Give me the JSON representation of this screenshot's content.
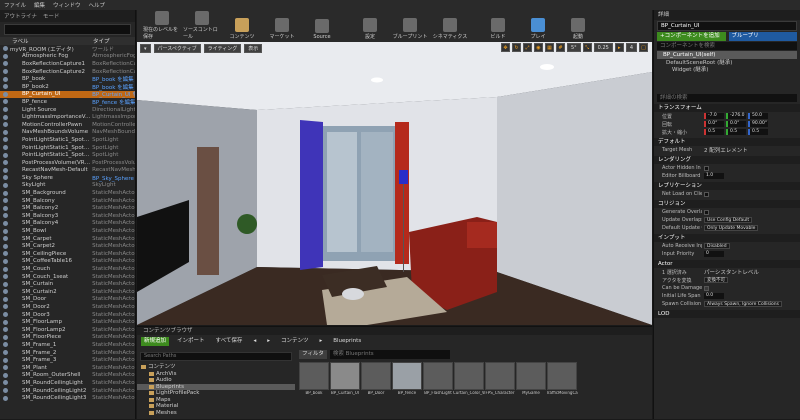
{
  "menu": [
    "ファイル",
    "編集",
    "ウィンドウ",
    "ヘルプ"
  ],
  "left_tabs": [
    "アウトライナ",
    "モード"
  ],
  "outliner": {
    "col_label": "ラベル",
    "col_type": "タイプ",
    "rows": [
      {
        "label": "myVR_ROOM (エディタ)",
        "type": "ワールド"
      },
      {
        "label": "Atmospheric Fog",
        "type": "AtmosphericFog"
      },
      {
        "label": "BoxReflectionCapture1",
        "type": "BoxReflectionCapture"
      },
      {
        "label": "BoxReflectionCapture2",
        "type": "BoxReflectionCapture"
      },
      {
        "label": "BP_book",
        "type": "BP_book を編集"
      },
      {
        "label": "BP_book2",
        "type": "BP_book を編集"
      },
      {
        "label": "BP_Curtain_UI",
        "type": "BP_Curtain_UI を編集"
      },
      {
        "label": "BP_fence",
        "type": "BP_fence を編集"
      },
      {
        "label": "Light Source",
        "type": "DirectionalLight"
      },
      {
        "label": "LightmassImportanceVolume",
        "type": "LightmassImportanceVolume"
      },
      {
        "label": "MotionControllerPawn",
        "type": "MotionControllerPawn"
      },
      {
        "label": "NavMeshBoundsVolume",
        "type": "NavMeshBoundsVolume"
      },
      {
        "label": "PointLightStatic1_SpotLight",
        "type": "SpotLight"
      },
      {
        "label": "PointLightStatic1_SpotLight2",
        "type": "SpotLight"
      },
      {
        "label": "PointLightStatic1_SpotLight3",
        "type": "SpotLight"
      },
      {
        "label": "PostProcessVolume(VRSetting)",
        "type": "PostProcessVolume"
      },
      {
        "label": "RecastNavMesh-Default",
        "type": "RecastNavMesh"
      },
      {
        "label": "Sky Sphere",
        "type": "BP_Sky_Sphere を編集"
      },
      {
        "label": "SkyLight",
        "type": "SkyLight"
      },
      {
        "label": "SM_Background",
        "type": "StaticMeshActor"
      },
      {
        "label": "SM_Balcony",
        "type": "StaticMeshActor"
      },
      {
        "label": "SM_Balcony2",
        "type": "StaticMeshActor"
      },
      {
        "label": "SM_Balcony3",
        "type": "StaticMeshActor"
      },
      {
        "label": "SM_Balcony4",
        "type": "StaticMeshActor"
      },
      {
        "label": "SM_Bowl",
        "type": "StaticMeshActor"
      },
      {
        "label": "SM_Carpet",
        "type": "StaticMeshActor"
      },
      {
        "label": "SM_Carpet2",
        "type": "StaticMeshActor"
      },
      {
        "label": "SM_CeilingPiece",
        "type": "StaticMeshActor"
      },
      {
        "label": "SM_CoffeeTable16",
        "type": "StaticMeshActor"
      },
      {
        "label": "SM_Couch",
        "type": "StaticMeshActor"
      },
      {
        "label": "SM_Couch_1seat",
        "type": "StaticMeshActor"
      },
      {
        "label": "SM_Curtain",
        "type": "StaticMeshActor"
      },
      {
        "label": "SM_Curtain2",
        "type": "StaticMeshActor"
      },
      {
        "label": "SM_Door",
        "type": "StaticMeshActor"
      },
      {
        "label": "SM_Door2",
        "type": "StaticMeshActor"
      },
      {
        "label": "SM_Door3",
        "type": "StaticMeshActor"
      },
      {
        "label": "SM_FloorLamp",
        "type": "StaticMeshActor"
      },
      {
        "label": "SM_FloorLamp2",
        "type": "StaticMeshActor"
      },
      {
        "label": "SM_FloorPiece",
        "type": "StaticMeshActor"
      },
      {
        "label": "SM_Frame_1",
        "type": "StaticMeshActor"
      },
      {
        "label": "SM_Frame_2",
        "type": "StaticMeshActor"
      },
      {
        "label": "SM_Frame_3",
        "type": "StaticMeshActor"
      },
      {
        "label": "SM_Plant",
        "type": "StaticMeshActor"
      },
      {
        "label": "SM_Room_OuterShell",
        "type": "StaticMeshActor"
      },
      {
        "label": "SM_RoundCeilingLight",
        "type": "StaticMeshActor"
      },
      {
        "label": "SM_RoundCeilingLight2",
        "type": "StaticMeshActor"
      },
      {
        "label": "SM_RoundCeilingLight3",
        "type": "StaticMeshActor"
      }
    ]
  },
  "toolbar": [
    {
      "label": "現在のレベルを保存"
    },
    {
      "label": "ソースコントロール"
    },
    {
      "label": "コンテンツ"
    },
    {
      "label": "マーケット"
    },
    {
      "label": "Source"
    },
    {
      "label": "設定"
    },
    {
      "label": "ブループリント"
    },
    {
      "label": "シネマティクス"
    },
    {
      "label": "ビルド"
    },
    {
      "label": "プレイ"
    },
    {
      "label": "起動"
    }
  ],
  "viewport": {
    "perspective": "パースペクティブ",
    "lighting": "ライティング",
    "show": "表示",
    "angle": "5°",
    "scale": "0.25",
    "cam": "4"
  },
  "content_browser": {
    "tab": "コンテンツブラウザ",
    "add_new": "新規追加",
    "import": "インポート",
    "save_all": "すべて保存",
    "path_root": "コンテンツ",
    "path_leaf": "Blueprints",
    "search_paths": "Search Paths",
    "filter": "フィルタ",
    "search_bp": "検索 Blueprints",
    "folders": [
      "コンテンツ",
      "ArchVis",
      "Audio",
      "Blueprints",
      "LightProfilePack",
      "Maps",
      "Material",
      "Meshes"
    ],
    "assets": [
      "BP_book",
      "BP_Curtain_UI",
      "BP_Door",
      "BP_fence",
      "BP_FlashLight",
      "Curtain_Color_Widget",
      "FPS_Character",
      "MyGame",
      "TrafficMovingCarLights"
    ]
  },
  "details": {
    "tab": "詳細",
    "name": "BP_Curtain_UI",
    "add_component": "+コンポーネントを追加",
    "blueprint": "ブループリ",
    "search_components": "コンポーネントを検索",
    "self": "BP_Curtain_UI(self)",
    "root": "DefaultSceneRoot (継承)",
    "widget": "Widget (継承)",
    "search_details": "詳細の検索",
    "transform": "トランスフォーム",
    "loc_label": "位置",
    "loc": [
      "-7.0",
      "-276.0",
      "50.0"
    ],
    "rot_label": "回転",
    "rot": [
      "0.0°",
      "0.0°",
      "90.00°"
    ],
    "scale_label": "拡大・縮小",
    "scale": [
      "0.5",
      "0.5",
      "0.5"
    ],
    "default": "デフォルト",
    "target_mesh": "Target Mesh",
    "target_mesh_val": "2 配列エレメント",
    "rendering": "レンダリング",
    "hidden": "Actor Hidden In Gar",
    "billboard": "Editor Billboard Sca",
    "billboard_val": "1.0",
    "replication": "レプリケーション",
    "net_load": "Net Load on Client",
    "collision": "コリジョン",
    "gen_overlap": "Generate Overlap E",
    "upd_overlap": "Update Overlaps M",
    "upd_overlap_val": "Use Config Default",
    "def_upd": "Default Update Ove",
    "def_upd_val": "Only Update Movable",
    "input": "インプット",
    "auto_input": "Auto Receive Input",
    "auto_input_val": "Disabled",
    "input_prio": "Input Priority",
    "input_prio_val": "0",
    "actor": "Actor",
    "selected": "1 選択済み",
    "actor_level": "パーシスタントレベル",
    "convert": "アクタを変換",
    "convert_val": "変換不可",
    "damaged": "Can be Damaged",
    "lifespan": "Initial Life Span",
    "lifespan_val": "0.0",
    "spawn": "Spawn Collision Har",
    "spawn_val": "Always Spawn, Ignore Collisions",
    "lod": "LOD"
  }
}
